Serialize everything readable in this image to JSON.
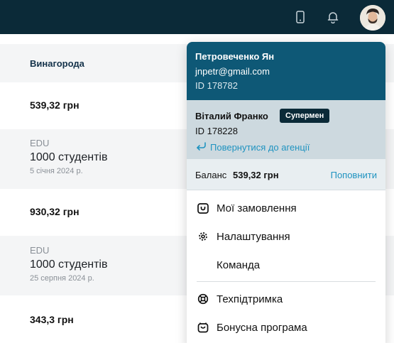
{
  "topbar": {
    "icons": [
      "phone-icon",
      "bell-icon"
    ],
    "avatar": "user-avatar"
  },
  "table": {
    "header": "Винагорода",
    "rows": [
      {
        "type": "sum",
        "value": "539,32 грн"
      },
      {
        "type": "edu",
        "label": "EDU",
        "value": "1000 студентів",
        "date": "5 січня 2024 р."
      },
      {
        "type": "sum",
        "value": "930,32 грн"
      },
      {
        "type": "edu",
        "label": "EDU",
        "value": "1000 студентів",
        "date": "25 серпня 2024 р."
      },
      {
        "type": "sum",
        "value": "343,3 грн"
      }
    ]
  },
  "menu": {
    "owner": {
      "name": "Петровеченко Ян",
      "email": "jnpetr@gmail.com",
      "id": "ID 178782"
    },
    "agent": {
      "name": "Віталий Франко",
      "badge": "Супермен",
      "id": "ID 178228",
      "back_label": "Повернутися до агенції"
    },
    "balance": {
      "label": "Баланс",
      "amount": "539,32 грн",
      "topup_label": "Поповнити"
    },
    "items": [
      {
        "label": "Мої замовлення",
        "icon": "orders-icon"
      },
      {
        "label": "Налаштування",
        "icon": "gear-icon"
      },
      {
        "label": "Команда",
        "icon": ""
      },
      {
        "label": "Техпідтримка",
        "icon": "lifebuoy-icon"
      },
      {
        "label": "Бонусна програма",
        "icon": "gift-icon"
      }
    ]
  },
  "colors": {
    "topbar": "#0b2a38",
    "owner_bg": "#0e5876",
    "agent_bg": "#cdd9df",
    "accent_link": "#1f93c0"
  }
}
